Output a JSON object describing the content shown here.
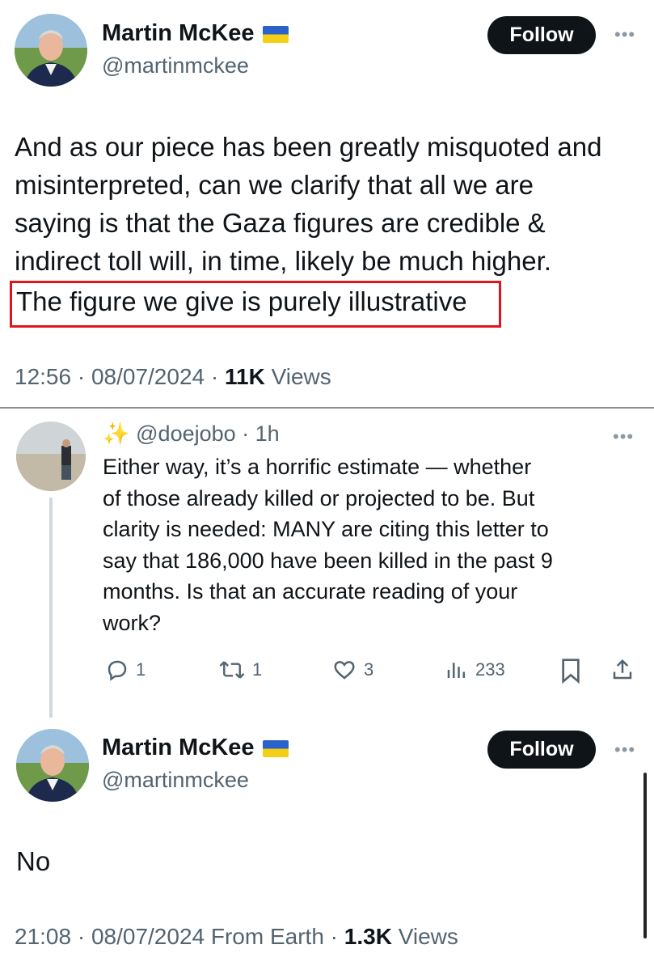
{
  "tweet1": {
    "author_name": "Martin McKee",
    "flag_icon": "ukraine-flag-icon",
    "handle": "@martinmckee",
    "follow_label": "Follow",
    "more_icon": "more-icon",
    "text_lines": [
      "And as our piece has been greatly misquoted and",
      "misinterpreted, can we clarify that all we are",
      "saying is that the Gaza figures are credible &",
      "indirect toll will, in time, likely be much higher."
    ],
    "highlighted_line": "The figure we give is purely illustrative",
    "highlight_color": "#e0141e",
    "time": "12:56 · 08/07/2024 · ",
    "views_count": "11K",
    "views_label": " Views"
  },
  "reply": {
    "sparkle": "✨",
    "handle": "@doejobo",
    "age": "· 1h",
    "text_lines": [
      "Either way, it’s a horrific estimate — whether",
      "of those already killed or projected to be. But",
      "clarity is needed: MANY are citing this letter to",
      "say that 186,000 have been killed in the past 9",
      "months. Is that an accurate reading of your",
      "work?"
    ],
    "replies": "1",
    "reposts": "1",
    "likes": "3",
    "views": "233"
  },
  "tweet2": {
    "author_name": "Martin McKee",
    "handle": "@martinmckee",
    "follow_label": "Follow",
    "text": "No",
    "time": "21:08 · 08/07/2024 From Earth · ",
    "views_count": "1.3K",
    "views_label": " Views"
  },
  "colors": {
    "primary_text": "#0f1419",
    "secondary_text": "#536471",
    "button_bg": "#0f1419"
  }
}
